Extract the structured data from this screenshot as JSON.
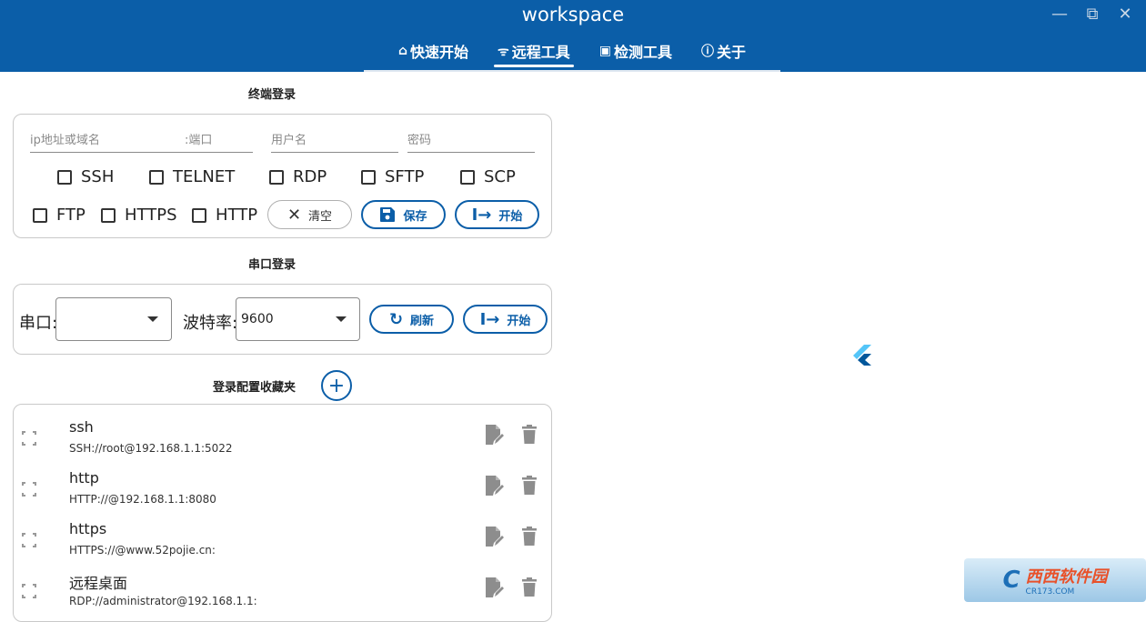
{
  "window": {
    "title": "workspace",
    "controls": {
      "minimize": "—",
      "maximize": "⧉",
      "close": "✕"
    }
  },
  "tabs": [
    {
      "icon": "⌂",
      "label": "快速开始"
    },
    {
      "icon": "ᯤ",
      "label": "远程工具"
    },
    {
      "icon": "▣",
      "label": "检测工具"
    },
    {
      "icon": "ⓘ",
      "label": "关于"
    }
  ],
  "active_tab": "远程工具",
  "terminal": {
    "title": "终端登录",
    "host_placeholder": "ip地址或域名",
    "port_placeholder": ":端口",
    "user_placeholder": "用户名",
    "password_placeholder": "密码",
    "protocols_row1": [
      "SSH",
      "TELNET",
      "RDP",
      "SFTP",
      "SCP"
    ],
    "protocols_row2": [
      "FTP",
      "HTTPS",
      "HTTP"
    ],
    "clear_label": "清空",
    "save_label": "保存",
    "start_label": "开始"
  },
  "serial": {
    "title": "串口登录",
    "port_label": "串口:",
    "port_value": "",
    "baud_label": "波特率:",
    "baud_value": "9600",
    "refresh_label": "刷新",
    "start_label": "开始"
  },
  "favorites": {
    "title": "登录配置收藏夹",
    "add_label": "+",
    "items": [
      {
        "name": "ssh",
        "url": "SSH://root@192.168.1.1:5022"
      },
      {
        "name": "http",
        "url": "HTTP://@192.168.1.1:8080"
      },
      {
        "name": "https",
        "url": "HTTPS://@www.52pojie.cn:"
      },
      {
        "name": "远程桌面",
        "url": "RDP://administrator@192.168.1.1:"
      }
    ]
  },
  "watermark": {
    "logo": "C",
    "cn": "西西软件园",
    "en": "CR173.COM"
  },
  "colors": {
    "primary": "#0b5ea8",
    "header_bg": "#0b5ea8",
    "border": "#c9c9c9"
  }
}
